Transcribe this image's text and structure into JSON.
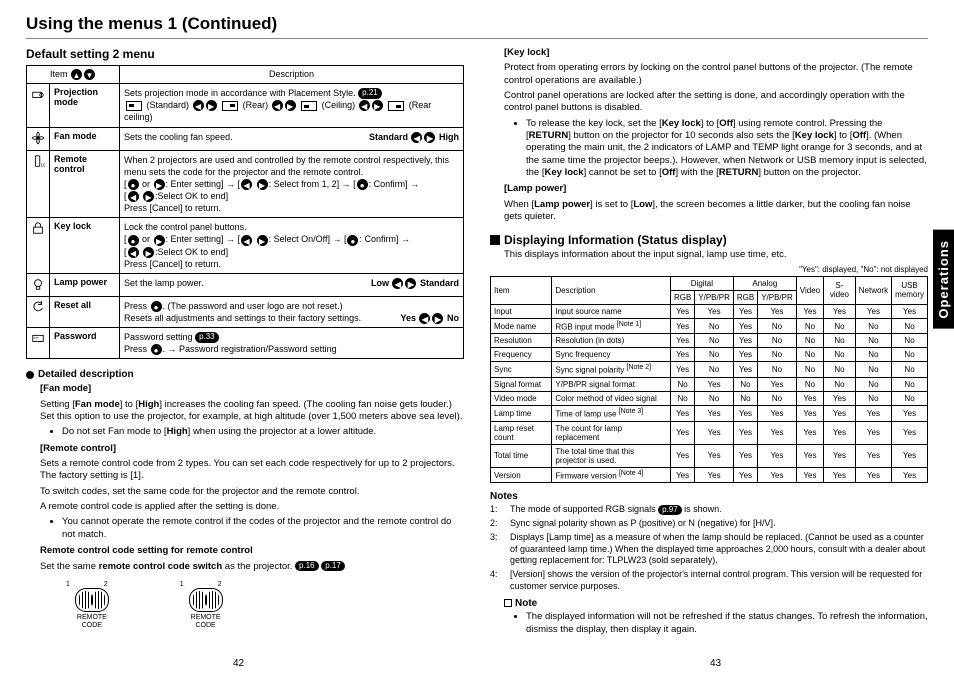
{
  "title": "Using the menus 1 (Continued)",
  "left": {
    "menu_title": "Default setting 2 menu",
    "thead": {
      "item": "Item",
      "desc": "Description"
    },
    "rows": {
      "proj_mode": {
        "label": "Projection mode",
        "desc": "Sets projection mode in accordance with Placement Style.",
        "ref": "p.21",
        "std": "(Standard)",
        "rear": "(Rear)",
        "ceil": "(Ceiling)",
        "rc": "(Rear ceiling)"
      },
      "fan": {
        "label": "Fan mode",
        "desc": "Sets the cooling fan speed.",
        "right": "Standard",
        "right2": "High"
      },
      "remote": {
        "label": "Remote control",
        "d1": "When 2 projectors are used and controlled by the remote control respectively, this menu sets the code for the projector and the remote control.",
        "d2": ": Enter setting] → [",
        "d2b": ": Select from 1, 2] → [",
        "d2c": ": Confirm] →",
        "d3": ":Select OK to end]",
        "d4": "Press [Cancel] to return."
      },
      "keylock": {
        "label": "Key lock",
        "d1": "Lock the control panel buttons.",
        "d2a": ": Enter setting] → [",
        "d2b": ": Select On/Off] → [",
        "d2c": ": Confirm] →",
        "d3": ":Select OK to end]",
        "d4": "Press [Cancel] to return."
      },
      "lamp": {
        "label": "Lamp power",
        "desc": "Set the lamp power.",
        "r1": "Low",
        "r2": "Standard"
      },
      "reset": {
        "label": "Reset all",
        "d1": "Press ",
        "d1b": ". (The password and user logo are not reset.)",
        "d2": "Resets all adjustments and settings to their factory settings.",
        "r1": "Yes",
        "r2": "No"
      },
      "pwd": {
        "label": "Password",
        "d1": "Password setting",
        "ref": "p.33",
        "d2": "Press ",
        "d2b": ". → Password registration/Password setting"
      }
    },
    "detailed_head": "Detailed description",
    "fan_head": "[Fan mode]",
    "fan_p1a": "Setting [",
    "fan_p1b": "Fan mode",
    "fan_p1c": "] to [",
    "fan_p1d": "High",
    "fan_p1e": "] increases the cooling fan speed. (The cooling fan noise gets louder.) Set this option to use the projector, for example, at high altitude (over 1,500 meters above sea level).",
    "fan_li": "Do not set Fan mode to [",
    "fan_li2": "] when using the projector at a lower altitude.",
    "rc_head": "[Remote control]",
    "rc_p1": "Sets a remote control code from 2 types. You can set each code respectively for up to 2 projectors. The factory setting is [1].",
    "rc_p2": "To switch codes, set the same code for the projector and the remote control.",
    "rc_p3": "A remote control code is applied after the setting is done.",
    "rc_li": "You cannot operate the remote control if the codes of the projector and the remote control do not match.",
    "rc_set_head": "Remote control code setting for remote control",
    "rc_set_p": "Set the same ",
    "rc_set_b": "remote control code switch",
    "rc_set_p2": " as the projector.",
    "rc_ref1": "p.16",
    "rc_ref2": "p.17",
    "fig_num": "1   2",
    "fig_lbl": "REMOTE\nCODE",
    "page": "42"
  },
  "right": {
    "kl_head": "[Key lock]",
    "kl_p1": "Protect from operating errors by locking on the control panel buttons of the projector. (The remote control operations are available.)",
    "kl_p2": "Control panel operations are locked after the setting is done, and accordingly operation with the control panel buttons is disabled.",
    "kl_li1a": "To release the key lock, set the [",
    "kl_li1b": "Key lock",
    "kl_li1c": "] to [",
    "kl_li1d": "Off",
    "kl_li1e": "] using remote control. Pressing the [",
    "kl_li1f": "RETURN",
    "kl_li1g": "] button on the projector for 10 seconds also sets the [",
    "kl_li1h": "] to [",
    "kl_li1i": "]. (When operating the main unit, the 2 indicators of LAMP and TEMP light orange for 3 seconds, and at the same time the projector beeps.). However, when Network or USB memory input is selected, the [",
    "kl_li1j": "] cannot be set to [",
    "kl_li1k": "] with the [",
    "kl_li1l": "] button on the projector.",
    "lp_head": "[Lamp power]",
    "lp_p": "When [",
    "lp_b1": "Lamp power",
    "lp_p2": "] is set to [",
    "lp_b2": "Low",
    "lp_p3": "], the screen becomes a little darker, but the cooling fan noise gets quieter.",
    "disp_head": "Displaying Information (Status display)",
    "disp_sub": "This displays information about the input signal, lamp use time, etc.",
    "matrix_note": "\"Yes\": displayed, \"No\": not displayed",
    "mthead": {
      "item": "Item",
      "desc": "Description",
      "digital": "Digital",
      "analog": "Analog",
      "rgb": "RGB",
      "ypbpr": "Y/PB/PR",
      "video": "Video",
      "svideo": "S-video",
      "network": "Network",
      "usb": "USB",
      "memory": "memory"
    },
    "mrows": [
      {
        "item": "Input",
        "desc": "Input source name",
        "v": [
          "Yes",
          "Yes",
          "Yes",
          "Yes",
          "Yes",
          "Yes",
          "Yes",
          "Yes"
        ]
      },
      {
        "item": "Mode name",
        "desc": "RGB input mode",
        "note": "[Note 1]",
        "v": [
          "Yes",
          "No",
          "Yes",
          "No",
          "No",
          "No",
          "No",
          "No"
        ]
      },
      {
        "item": "Resolution",
        "desc": "Resolution (in dots)",
        "v": [
          "Yes",
          "No",
          "Yes",
          "No",
          "No",
          "No",
          "No",
          "No"
        ]
      },
      {
        "item": "Frequency",
        "desc": "Sync frequency",
        "v": [
          "Yes",
          "No",
          "Yes",
          "No",
          "No",
          "No",
          "No",
          "No"
        ]
      },
      {
        "item": "Sync",
        "desc": "Sync signal polarity",
        "note": "[Note 2]",
        "v": [
          "Yes",
          "No",
          "Yes",
          "No",
          "No",
          "No",
          "No",
          "No"
        ]
      },
      {
        "item": "Signal format",
        "desc": "Y/PB/PR signal format",
        "v": [
          "No",
          "Yes",
          "No",
          "Yes",
          "No",
          "No",
          "No",
          "No"
        ]
      },
      {
        "item": "Video mode",
        "desc": "Color method of video signal",
        "v": [
          "No",
          "No",
          "No",
          "No",
          "Yes",
          "Yes",
          "No",
          "No"
        ]
      },
      {
        "item": "Lamp time",
        "desc": "Time of lamp use",
        "note": "[Note 3]",
        "v": [
          "Yes",
          "Yes",
          "Yes",
          "Yes",
          "Yes",
          "Yes",
          "Yes",
          "Yes"
        ]
      },
      {
        "item": "Lamp reset count",
        "desc": "The count for lamp replacement",
        "v": [
          "Yes",
          "Yes",
          "Yes",
          "Yes",
          "Yes",
          "Yes",
          "Yes",
          "Yes"
        ]
      },
      {
        "item": "Total time",
        "desc": "The total time that this projector is used.",
        "v": [
          "Yes",
          "Yes",
          "Yes",
          "Yes",
          "Yes",
          "Yes",
          "Yes",
          "Yes"
        ]
      },
      {
        "item": "Version",
        "desc": "Firmware version",
        "note": "[Note 4]",
        "v": [
          "Yes",
          "Yes",
          "Yes",
          "Yes",
          "Yes",
          "Yes",
          "Yes",
          "Yes"
        ]
      }
    ],
    "notes_head": "Notes",
    "notes": {
      "1": {
        "a": "The mode of supported RGB signals ",
        "ref": "p.97",
        "b": " is shown."
      },
      "2": "Sync signal polarity shown as P (positive) or N (negative) for [H/V].",
      "3": "Displays [Lamp time] as a measure of when the lamp should be replaced. (Cannot be used as a counter of guaranteed lamp time.) When the displayed time approaches 2,000 hours, consult with a dealer about getting replacement for: TLPLW23 (sold separately).",
      "4": "[Version] shows the version of the projector's internal control program. This version will be requested for customer service purposes."
    },
    "note_box_h": "Note",
    "note_box": "The displayed information will not be refreshed if the status changes. To refresh the information, dismiss the display, then display it again.",
    "page": "43"
  },
  "side_tab": "Operations"
}
